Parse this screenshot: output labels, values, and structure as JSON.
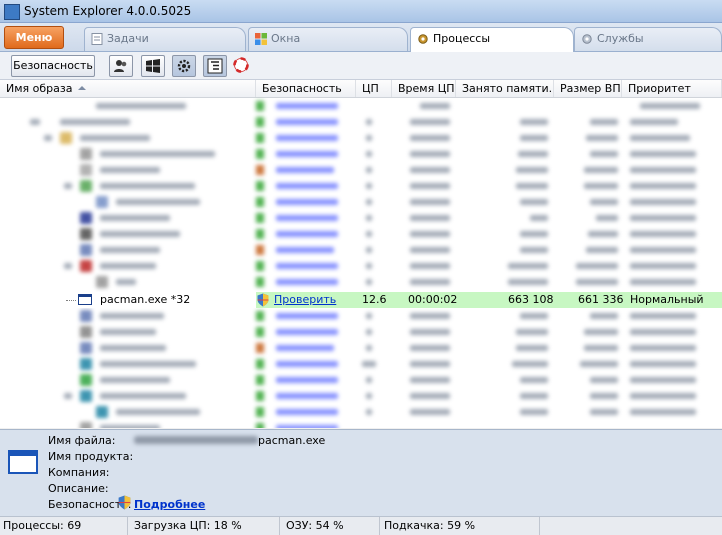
{
  "window": {
    "title": "System Explorer 4.0.0.5025"
  },
  "menu": {
    "label": "Меню"
  },
  "tabs": [
    {
      "label": "Задачи",
      "icon": "tasks-icon"
    },
    {
      "label": "Окна",
      "icon": "windows-icon"
    },
    {
      "label": "Процессы",
      "icon": "gear-icon",
      "active": true
    },
    {
      "label": "Службы",
      "icon": "services-gear-icon"
    }
  ],
  "toolbar": {
    "security_label": "Безопасность",
    "icons": [
      "users-icon",
      "windows-logo-icon",
      "gear-icon",
      "tree-view-icon",
      "lifebuoy-icon"
    ]
  },
  "table": {
    "columns": [
      "Имя образа",
      "Безопасность",
      "ЦП",
      "Время ЦП",
      "Занято памяти...",
      "Размер ВП",
      "Приоритет"
    ],
    "selected_row": {
      "name": "pacman.exe *32",
      "security": "Проверить",
      "cpu": "12.6",
      "cpu_time": "00:00:02",
      "memory": "663 108",
      "vm_size": "661 336",
      "priority": "Нормальный"
    }
  },
  "details": {
    "file_name_label": "Имя файла:",
    "file_name_value": "pacman.exe",
    "product_label": "Имя продукта:",
    "company_label": "Компания:",
    "description_label": "Описание:",
    "security_label": "Безопасность:",
    "more_link": "Подробнее"
  },
  "status": {
    "processes": "Процессы: 69",
    "cpu_load": "Загрузка ЦП: 18 %",
    "ram": "ОЗУ: 54 %",
    "swap": "Подкачка: 59 %"
  },
  "colors": {
    "accent": "#e06a1c",
    "selected_row": "#c7f7c2",
    "link": "#0033cc"
  }
}
